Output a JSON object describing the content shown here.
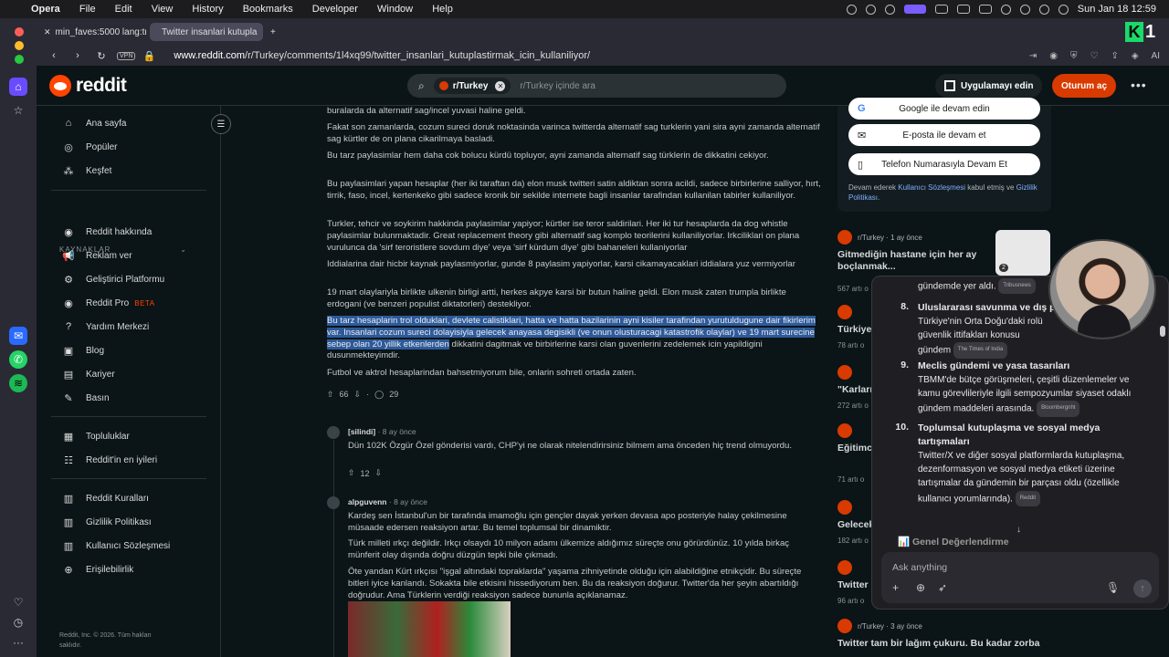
{
  "menubar": {
    "app": "Opera",
    "items": [
      "File",
      "Edit",
      "View",
      "History",
      "Bookmarks",
      "Developer",
      "Window",
      "Help"
    ],
    "clock": "Sun Jan 18  12:59"
  },
  "tabs": [
    {
      "label": "min_faves:5000 lang:tr"
    },
    {
      "label": "Twitter insanlari kutupla"
    }
  ],
  "address": {
    "vpn": "VPN",
    "domain": "www.reddit.com",
    "path": "/r/Turkey/comments/1l4xq99/twitter_insanlari_kutuplastirmak_icin_kullaniliyor/",
    "ai": "AI"
  },
  "header": {
    "logo": "reddit",
    "search_chip": "r/Turkey",
    "search_placeholder": "r/Turkey içinde ara",
    "app_button": "Uygulamayı edin",
    "login_button": "Oturum aç"
  },
  "sidebar": {
    "main": [
      {
        "label": "Ana sayfa",
        "icon": "home-icon"
      },
      {
        "label": "Popüler",
        "icon": "popular-icon"
      },
      {
        "label": "Keşfet",
        "icon": "explore-icon"
      }
    ],
    "resources_heading": "KAYNAKLAR",
    "resources": [
      {
        "label": "Reddit hakkında"
      },
      {
        "label": "Reklam ver"
      },
      {
        "label": "Geliştirici Platformu"
      },
      {
        "label": "Reddit Pro",
        "badge": "BETA"
      },
      {
        "label": "Yardım Merkezi"
      },
      {
        "label": "Blog"
      },
      {
        "label": "Kariyer"
      },
      {
        "label": "Basın"
      }
    ],
    "communities": [
      {
        "label": "Topluluklar"
      },
      {
        "label": "Reddit'in en iyileri"
      }
    ],
    "policies": [
      {
        "label": "Reddit Kuralları"
      },
      {
        "label": "Gizlilik Politikası"
      },
      {
        "label": "Kullanıcı Sözleşmesi"
      },
      {
        "label": "Erişilebilirlik"
      }
    ],
    "footer": "Reddit, Inc. © 2026. Tüm hakları saklıdır."
  },
  "post": {
    "p0": "buralarda da alternatif sag/incel yuvasi haline geldi.",
    "p1": "Fakat son zamanlarda, cozum sureci doruk noktasinda varinca twitterda alternatif sag turklerin yani sira ayni zamanda alternatif sag kürtler de on plana cikarilmaya basladi.",
    "p2": "Bu tarz paylasimlar hem daha cok bolucu kürdü topluyor, ayni zamanda alternatif sag türklerin de dikkatini cekiyor.",
    "p3": "Bu paylasimlari yapan hesaplar (her iki taraftan da) elon musk twitteri satin aldiktan sonra acildi, sadece birbirlerine salliyor, hırt, tirrik, faso, incel, kertenkeko gibi sadece kronik bir sekilde internete bagli insanlar tarafindan kullanilan tabirler kullaniliyor.",
    "p4": "Turkler, tehcir ve soykirim hakkinda paylasimlar yapiyor; kürtler ise teror saldirilari. Her iki tur hesaplarda da dog whistle paylasimlar bulunmaktadir. Great replacement theory gibi alternatif sag komplo teorilerini kullaniliyorlar. Irkciliklari on plana vurulunca da 'sirf teroristlere sovdum diye' veya 'sirf kürdum diye' gibi bahaneleri kullaniyorlar",
    "p5": "Iddialarina dair hicbir kaynak paylasmiyorlar, gunde 8 paylasim yapiyorlar, karsi cikamayacaklari iddialara yuz vermiyorlar",
    "p6": "19 mart olaylariyla birlikte ulkenin birligi artti, herkes akpye karsi bir butun haline geldi. Elon musk zaten trumpla birlikte erdogani (ve benzeri populist diktatorleri) destekliyor.",
    "p7_highlight": "Bu tarz hesaplarin trol olduklari, devlete calistiklari, hatta ve hatta bazilarinin ayni kisiler tarafindan yurutuldugune dair fikirlerim var. Insanlari cozum sureci dolayisiyla gelecek anayasa degisikli (ve onun olusturacagi katastrofik olaylar) ve 19 mart surecine sebep olan 20 yillik etkenlerden",
    "p7_rest": " dikkatini dagitmak ve birbirlerine karsi olan guvenlerini zedelemek icin yapildigini dusunmekteyimdir.",
    "p8": "Futbol ve aktrol hesaplarindan bahsetmiyorum bile, onlarin sohreti ortada zaten.",
    "votes": "66",
    "comments": "29"
  },
  "comments": [
    {
      "author": "[silindi]",
      "time": "· 8 ay önce",
      "body": "Dün 102K Özgür Özel gönderisi vardı, CHP'yi ne olarak nitelendirirsiniz bilmem ama önceden hiç trend olmuyordu.",
      "votes": "12"
    },
    {
      "author": "alpguvenn",
      "time": "· 8 ay önce",
      "b1": "Kardeş sen İstanbul'un bir tarafında imamoğlu için gençler dayak yerken devasa apo posteriyle halay çekilmesine müsaade edersen reaksiyon artar. Bu temel toplumsal bir dinamiktir.",
      "b2": "Türk milleti ırkçı değildir. Irkçı olsaydı 10 milyon adamı ülkemize aldığımız süreçte onu görürdünüz. 10 yılda birkaç münferit olay dışında doğru düzgün tepki bile çıkmadı.",
      "b3": "Öte yandan Kürt ırkçısı \"işgal altındaki topraklarda\" yaşama zihniyetinde olduğu için alabildiğine etnikçidir. Bu süreçte bitleri iyice kanlandı. Sokakta bile etkisini hissediyorum ben. Bu da reaksiyon doğurur. Twitter'da her şeyin abartıldığı doğrudur. Ama Türklerin verdiği reaksiyon sadece bununla açıklanamaz."
    }
  ],
  "auth": {
    "google": "Google ile devam edin",
    "email": "E-posta ile devam et",
    "phone": "Telefon Numarasıyla Devam Et",
    "note_pre": "Devam ederek ",
    "note_link1": "Kullanıcı Sözleşmesi",
    "note_mid": " kabul etmiş ve ",
    "note_link2": "Gizlilik Politikası",
    "note_post": "."
  },
  "related": [
    {
      "sub": "r/Turkey",
      "time": "· 1 ay önce",
      "title": "Gitmediğin hastane için her ay boçlanmak...",
      "meta": "567 artı o",
      "badge": "2"
    },
    {
      "sub": "",
      "time": "",
      "title": "Türkiye",
      "meta": "78 artı o"
    },
    {
      "sub": "",
      "time": "",
      "title": "\"Karları",
      "meta": "272 artı o"
    },
    {
      "sub": "",
      "time": "",
      "title": "Eğitimc",
      "meta": "71 artı o"
    },
    {
      "sub": "",
      "time": "",
      "title": "Gelecek",
      "meta": "182 artı o"
    },
    {
      "sub": "",
      "time": "",
      "title": "Twitter",
      "meta": "96 artı o"
    },
    {
      "sub": "r/Turkey",
      "time": "· 3 ay önce",
      "title": "Twitter tam bir lağım çukuru. Bu kadar zorba",
      "meta": ""
    }
  ],
  "assistant": {
    "top_line": "gündemde yer aldı.",
    "top_src": "Tribusnews",
    "items": [
      {
        "num": "8.",
        "title": "Uluslararası savunma ve dış p",
        "text": "Türkiye'nin Orta Doğu'daki rolü güvenlik ittifakları konusu gündem",
        "src": "The Times of India"
      },
      {
        "num": "9.",
        "title": "Meclis gündemi ve yasa tasarıları",
        "text": "TBMM'de bütçe görüşmeleri, çeşitli düzenlemeler ve kamu görevlileriyle ilgili sempozyumlar siyaset odaklı gündem maddeleri arasında.",
        "src": "Bloombergnht"
      },
      {
        "num": "10.",
        "title": "Toplumsal kutuplaşma ve sosyal medya tartışmaları",
        "text": "Twitter/X ve diğer sosyal platformlarda kutuplaşma, dezenformasyon ve sosyal medya etiketi üzerine tartışmalar da gündemin bir parçası oldu (özellikle kullanıcı yorumlarında).",
        "src": "Reddit"
      }
    ],
    "summary": "📊 Genel Değerlendirme",
    "placeholder": "Ask anything"
  }
}
